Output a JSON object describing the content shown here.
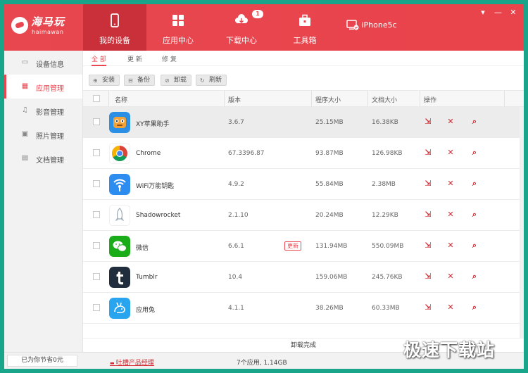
{
  "app": {
    "brand_name": "海马玩",
    "brand_sub": "haimawan",
    "accent": "#e8474f"
  },
  "nav": [
    {
      "label": "我的设备",
      "icon": "phone-icon",
      "active": true
    },
    {
      "label": "应用中心",
      "icon": "apps-grid-icon"
    },
    {
      "label": "下载中心",
      "icon": "cloud-download-icon",
      "badge": "1"
    },
    {
      "label": "工具箱",
      "icon": "toolbox-icon"
    }
  ],
  "device": {
    "name": "iPhone5c",
    "icon": "device-connected-icon"
  },
  "window_controls": {
    "menu": "▾",
    "minimize": "—",
    "close": "✕"
  },
  "sidebar": [
    {
      "label": "设备信息",
      "icon": "monitor-icon"
    },
    {
      "label": "应用管理",
      "icon": "apps-icon",
      "active": true
    },
    {
      "label": "影音管理",
      "icon": "music-icon"
    },
    {
      "label": "照片管理",
      "icon": "photo-icon"
    },
    {
      "label": "文档管理",
      "icon": "document-icon"
    }
  ],
  "subtabs": [
    {
      "label": "全 部",
      "active": true
    },
    {
      "label": "更 新"
    },
    {
      "label": "修 复"
    }
  ],
  "toolbar": [
    {
      "label": "安装",
      "icon": "install-icon"
    },
    {
      "label": "备份",
      "icon": "backup-icon"
    },
    {
      "label": "卸载",
      "icon": "uninstall-icon"
    },
    {
      "label": "刷新",
      "icon": "refresh-icon"
    }
  ],
  "table": {
    "headers": {
      "name": "名称",
      "version": "版本",
      "program_size": "程序大小",
      "doc_size": "文档大小",
      "actions": "操作"
    },
    "rows": [
      {
        "name": "XY苹果助手",
        "version": "3.6.7",
        "program_size": "25.15MB",
        "doc_size": "16.38KB",
        "icon": "xy-assistant-icon",
        "selected": true
      },
      {
        "name": "Chrome",
        "version": "67.3396.87",
        "program_size": "93.87MB",
        "doc_size": "126.98KB",
        "icon": "chrome-icon"
      },
      {
        "name": "WiFi万能钥匙",
        "version": "4.9.2",
        "program_size": "55.84MB",
        "doc_size": "2.38MB",
        "icon": "wifi-key-icon"
      },
      {
        "name": "Shadowrocket",
        "version": "2.1.10",
        "program_size": "20.24MB",
        "doc_size": "12.29KB",
        "icon": "shadowrocket-icon"
      },
      {
        "name": "微信",
        "version": "6.6.1",
        "update_label": "更新",
        "program_size": "131.94MB",
        "doc_size": "550.09MB",
        "icon": "wechat-icon"
      },
      {
        "name": "Tumblr",
        "version": "10.4",
        "program_size": "159.06MB",
        "doc_size": "245.76KB",
        "icon": "tumblr-icon"
      },
      {
        "name": "应用兔",
        "version": "4.1.1",
        "program_size": "38.26MB",
        "doc_size": "60.33MB",
        "icon": "app-rabbit-icon"
      }
    ]
  },
  "main_footer": "卸载完成",
  "status": {
    "saved": "已为你节省0元",
    "feedback": "吐槽产品经理",
    "summary": "7个应用, 1.14GB"
  },
  "watermark": "极速下载站"
}
